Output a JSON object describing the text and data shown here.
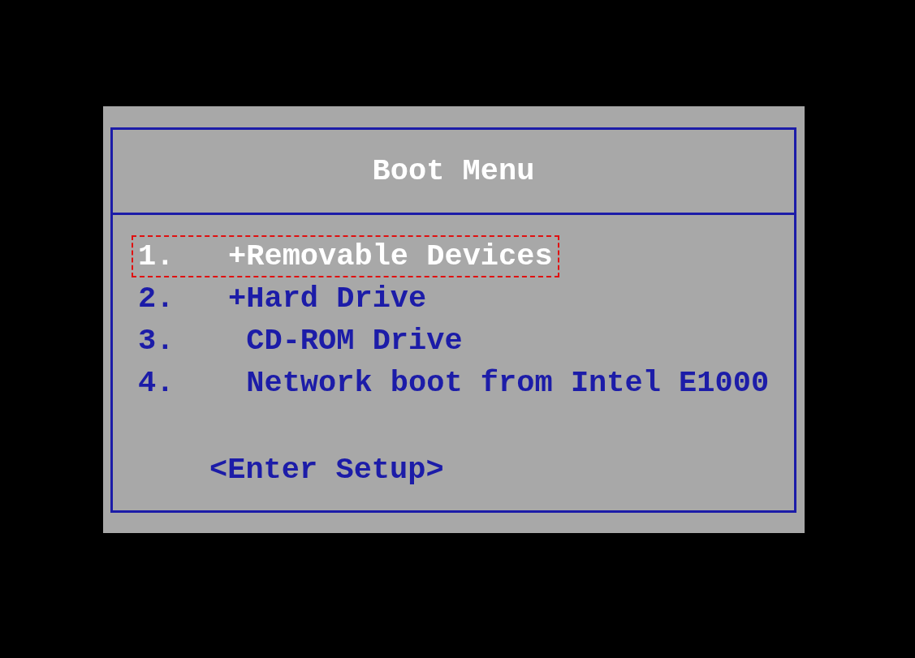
{
  "title": "Boot Menu",
  "items": [
    {
      "number": "1.",
      "label": "+Removable Devices",
      "kind": "group",
      "selected": true
    },
    {
      "number": "2.",
      "label": "+Hard Drive",
      "kind": "group",
      "selected": false
    },
    {
      "number": "3.",
      "label": "CD-ROM Drive",
      "kind": "device",
      "selected": false
    },
    {
      "number": "4.",
      "label": "Network boot from Intel E1000",
      "kind": "device",
      "selected": false
    }
  ],
  "setup": "<Enter Setup>"
}
